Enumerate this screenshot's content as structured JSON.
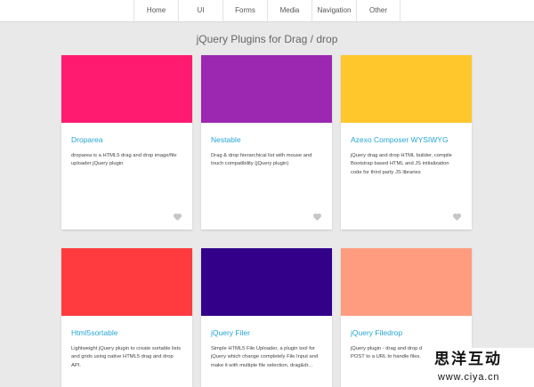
{
  "theme": {
    "background": "#e9e9e9",
    "accent": "#25a6d3"
  },
  "nav": {
    "items": [
      "Home",
      "UI",
      "Forms",
      "Media",
      "Navigation",
      "Other"
    ]
  },
  "page": {
    "title": "jQuery Plugins for Drag / drop"
  },
  "cards": [
    {
      "title": "Droparea",
      "color": "#ff1b6f",
      "description": [
        "droparea is a HTML5 drag and drop image/file",
        "uploader jQuery plugin"
      ],
      "like_icon": "heart-icon"
    },
    {
      "title": "Nestable",
      "color": "#9c27b0",
      "description": [
        "Drag & drop hierarchical list with mouse and",
        "touch compatibility (jQuery plugin)"
      ],
      "like_icon": "heart-icon"
    },
    {
      "title": "Azexo Composer WYSIWYG",
      "color": "#ffc72b",
      "description": [
        "jQuery drag and drop HTML builder, compile",
        "Bootstrap based HTML and JS initialization",
        "code for third party JS libraries"
      ],
      "like_icon": "heart-icon"
    },
    {
      "title": "Html5sortable",
      "color": "#ff3b3f",
      "description": [
        "Lightweight jQuery plugin to create sortable lists",
        "and grids using native HTML5 drag and drop",
        "API."
      ]
    },
    {
      "title": "jQuery Filer",
      "color": "#320089",
      "description": [
        "Simple HTML5 File Uploader, a plugin tool for",
        "jQuery which change completely File Input and",
        "make it with multiple file selection, drag&dr..."
      ]
    },
    {
      "title": "jQuery Filedrop",
      "color": "#ff9c80",
      "description": [
        "jQuery plugin - drag and drop d",
        "POST to a URL to handle files."
      ]
    }
  ],
  "watermark": {
    "brand": "思洋互动",
    "url": "www.ciya.cn"
  }
}
